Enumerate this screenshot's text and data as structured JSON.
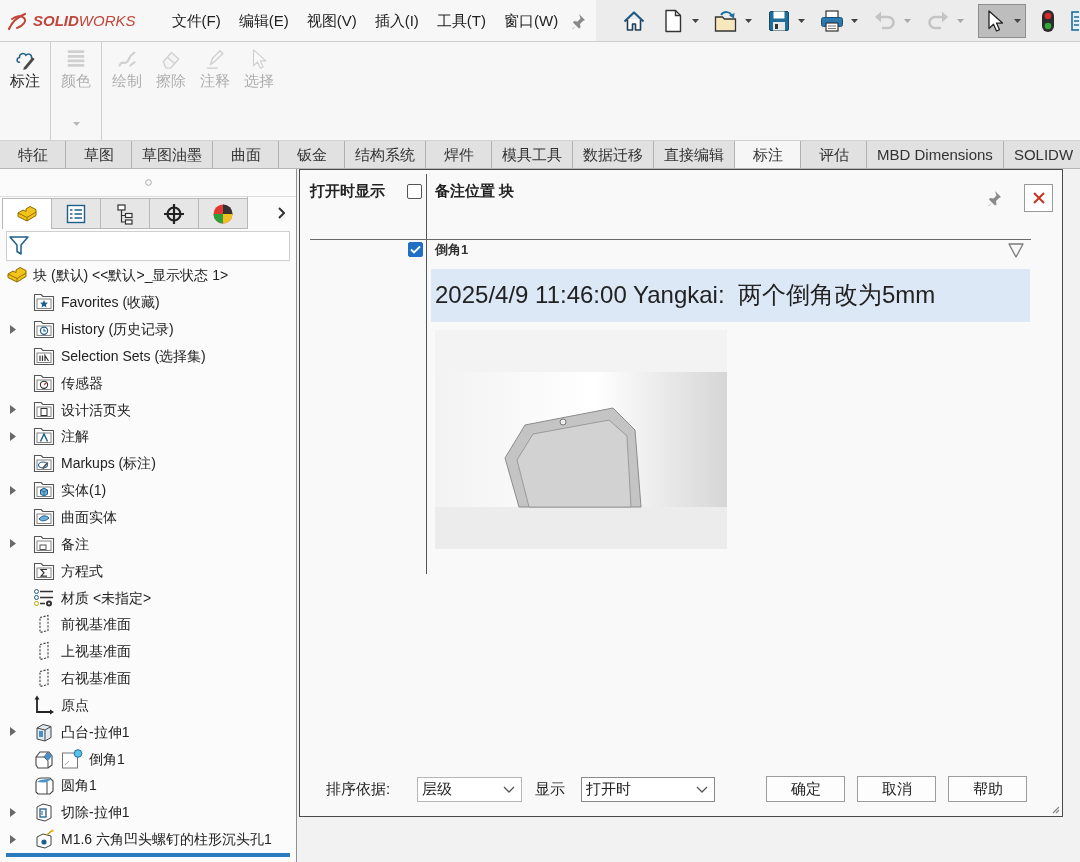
{
  "title_bar": {
    "logo_text": "**SOLID**WORKS",
    "menu": [
      "文件(F)",
      "编辑(E)",
      "视图(V)",
      "插入(I)",
      "工具(T)",
      "窗口(W)"
    ]
  },
  "quick_access": [
    {
      "kind": "home",
      "dropdown": false,
      "disabled": false,
      "pressed": false
    },
    {
      "kind": "new_document",
      "dropdown": true,
      "disabled": false,
      "pressed": false
    },
    {
      "kind": "open",
      "dropdown": true,
      "disabled": false,
      "pressed": false
    },
    {
      "kind": "save",
      "dropdown": true,
      "disabled": false,
      "pressed": false
    },
    {
      "kind": "print",
      "dropdown": true,
      "disabled": false,
      "pressed": false
    },
    {
      "kind": "undo",
      "dropdown": true,
      "disabled": true,
      "pressed": false
    },
    {
      "kind": "redo",
      "dropdown": true,
      "disabled": true,
      "pressed": false
    },
    {
      "kind": "select",
      "dropdown": true,
      "disabled": false,
      "pressed": true
    },
    {
      "kind": "rebuild",
      "dropdown": false,
      "disabled": false,
      "pressed": false
    },
    {
      "kind": "options",
      "dropdown": false,
      "disabled": false,
      "pressed": false
    }
  ],
  "ribbon": {
    "groups": [
      [
        {
          "kind": "markup",
          "label": "标注",
          "disabled": false,
          "dropdown": false
        }
      ],
      [
        {
          "kind": "color",
          "label": "颜色",
          "disabled": true,
          "dropdown": true
        }
      ],
      [
        {
          "kind": "draw",
          "label": "绘制",
          "disabled": true,
          "dropdown": false
        },
        {
          "kind": "erase",
          "label": "擦除",
          "disabled": true,
          "dropdown": false
        },
        {
          "kind": "annotate",
          "label": "注释",
          "disabled": true,
          "dropdown": false
        },
        {
          "kind": "select",
          "label": "选择",
          "disabled": true,
          "dropdown": false
        }
      ]
    ]
  },
  "tabs": [
    {
      "label": "特征",
      "selected": false
    },
    {
      "label": "草图",
      "selected": false
    },
    {
      "label": "草图油墨",
      "selected": false
    },
    {
      "label": "曲面",
      "selected": false
    },
    {
      "label": "钣金",
      "selected": false
    },
    {
      "label": "结构系统",
      "selected": false
    },
    {
      "label": "焊件",
      "selected": false
    },
    {
      "label": "模具工具",
      "selected": false
    },
    {
      "label": "数据迁移",
      "selected": false
    },
    {
      "label": "直接编辑",
      "selected": false
    },
    {
      "label": "标注",
      "selected": true
    },
    {
      "label": "评估",
      "selected": false
    },
    {
      "label": "MBD Dimensions",
      "selected": false
    },
    {
      "label": "SOLIDW",
      "selected": false
    }
  ],
  "feature_manager": {
    "panel_tabs": [
      {
        "kind": "feature_tree",
        "selected": true
      },
      {
        "kind": "property_manager",
        "selected": false
      },
      {
        "kind": "configuration_manager",
        "selected": false
      },
      {
        "kind": "dimxpert",
        "selected": false
      },
      {
        "kind": "display_manager",
        "selected": false
      }
    ],
    "tree": {
      "label": "块 (默认) <<默认>_显示状态 1>",
      "kind": "part",
      "children": [
        {
          "label": "Favorites (收藏)",
          "kind": "favorites",
          "expander": false,
          "note": false
        },
        {
          "label": "History (历史记录)",
          "kind": "history",
          "expander": true,
          "note": false
        },
        {
          "label": "Selection Sets (选择集)",
          "kind": "selection_sets",
          "expander": false,
          "note": false
        },
        {
          "label": "传感器",
          "kind": "sensors",
          "expander": false,
          "note": false
        },
        {
          "label": "设计活页夹",
          "kind": "design_binder",
          "expander": true,
          "note": false
        },
        {
          "label": "注解",
          "kind": "annotations",
          "expander": true,
          "note": false
        },
        {
          "label": "Markups (标注)",
          "kind": "markups",
          "expander": false,
          "note": false
        },
        {
          "label": "实体(1)",
          "kind": "solid_bodies",
          "expander": true,
          "note": false
        },
        {
          "label": "曲面实体",
          "kind": "surface_bodies",
          "expander": false,
          "note": false
        },
        {
          "label": "备注",
          "kind": "notes",
          "expander": true,
          "note": false
        },
        {
          "label": "方程式",
          "kind": "equations",
          "expander": false,
          "note": false
        },
        {
          "label": "材质 <未指定>",
          "kind": "material",
          "expander": false,
          "note": false
        },
        {
          "label": "前视基准面",
          "kind": "plane",
          "expander": false,
          "note": false
        },
        {
          "label": "上视基准面",
          "kind": "plane",
          "expander": false,
          "note": false
        },
        {
          "label": "右视基准面",
          "kind": "plane",
          "expander": false,
          "note": false
        },
        {
          "label": "原点",
          "kind": "origin",
          "expander": false,
          "note": false
        },
        {
          "label": "凸台-拉伸1",
          "kind": "boss_extrude",
          "expander": true,
          "note": false
        },
        {
          "label": "倒角1",
          "kind": "chamfer",
          "expander": false,
          "note": true
        },
        {
          "label": "圆角1",
          "kind": "fillet",
          "expander": false,
          "note": false
        },
        {
          "label": "切除-拉伸1",
          "kind": "cut_extrude",
          "expander": true,
          "note": false
        },
        {
          "label": "M1.6 六角凹头螺钉的柱形沉头孔1",
          "kind": "hole_wizard",
          "expander": true,
          "note": false
        }
      ]
    }
  },
  "dialog": {
    "show_on_open": {
      "label": "打开时显示",
      "checked": false
    },
    "title": "备注位置 块",
    "notes": [
      {
        "feature": "倒角1",
        "checked": true,
        "text": "2025/4/9 11:46:00 Yangkai:  两个倒角改为5mm",
        "image": true
      }
    ],
    "sort": {
      "label": "排序依据:",
      "value": "层级"
    },
    "show": {
      "label": "显示",
      "value": "打开时"
    },
    "buttons": [
      "确定",
      "取消",
      "帮助"
    ]
  }
}
